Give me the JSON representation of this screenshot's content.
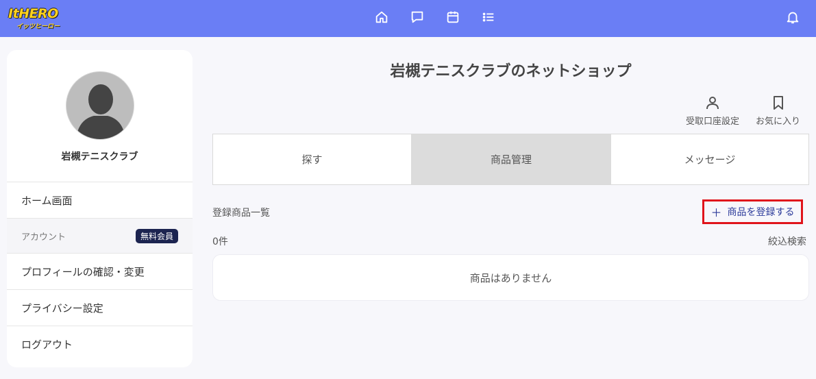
{
  "colors": {
    "header": "#6a7ef5",
    "badge": "#1c2450",
    "highlight": "#e0141b",
    "link": "#2b3a9a"
  },
  "header": {
    "logo_line1": "ItHERO",
    "logo_line2": "イッツヒーロー",
    "icons": [
      "home-icon",
      "chat-icon",
      "calendar-icon",
      "list-icon",
      "bell-icon"
    ]
  },
  "sidebar": {
    "profile_name": "岩槻テニスクラブ",
    "items": [
      {
        "label": "ホーム画面"
      },
      {
        "label": "プロフィールの確認・変更"
      },
      {
        "label": "プライバシー設定"
      },
      {
        "label": "ログアウト"
      }
    ],
    "section": {
      "label": "アカウント",
      "badge": "無料会員"
    }
  },
  "main": {
    "title": "岩槻テニスクラブのネットショップ",
    "actions": [
      {
        "label": "受取口座設定",
        "icon": "person-icon"
      },
      {
        "label": "お気に入り",
        "icon": "bookmark-icon"
      }
    ],
    "tabs": [
      {
        "label": "探す"
      },
      {
        "label": "商品管理",
        "active": true
      },
      {
        "label": "メッセージ"
      }
    ],
    "list_title": "登録商品一覧",
    "register_button": "商品を登録する",
    "count": "0件",
    "filter": "絞込検索",
    "empty_message": "商品はありません"
  }
}
